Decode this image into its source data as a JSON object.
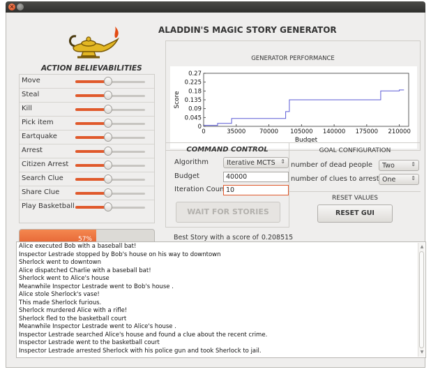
{
  "window": {
    "close_glyph": "×"
  },
  "app_title": "ALADDIN'S MAGIC STORY GENERATOR",
  "logo_icon": "magic-lamp-icon",
  "action_title": "ACTION BELIEVABILITIES",
  "actions": [
    {
      "label": "Move",
      "value": 0.47
    },
    {
      "label": "Steal",
      "value": 0.47
    },
    {
      "label": "Kill",
      "value": 0.47
    },
    {
      "label": "Pick item",
      "value": 0.47
    },
    {
      "label": "Eartquake",
      "value": 0.47
    },
    {
      "label": "Arrest",
      "value": 0.47
    },
    {
      "label": "Citizen Arrest",
      "value": 0.47
    },
    {
      "label": "Search Clue",
      "value": 0.47
    },
    {
      "label": "Share Clue",
      "value": 0.47
    },
    {
      "label": "Play Basketball",
      "value": 0.47
    }
  ],
  "progress": {
    "value": 0.57,
    "label": "57%"
  },
  "performance": {
    "title": "GENERATOR PERFORMANCE",
    "chart_data": {
      "type": "line",
      "xlabel": "Budget",
      "ylabel": "Score",
      "xlim": [
        0,
        220000
      ],
      "ylim": [
        0,
        0.27
      ],
      "xticks": [
        "0",
        "35000",
        "70000",
        "105000",
        "140000",
        "175000",
        "210000"
      ],
      "yticks": [
        "0",
        "0.045",
        "0.09",
        "0.135",
        "0.18",
        "0.225",
        "0.27"
      ],
      "series": [
        {
          "color": "#5a5ad6",
          "x": [
            0,
            15000,
            15000,
            30000,
            30000,
            88000,
            88000,
            92000,
            92000,
            190000,
            190000,
            210000,
            210000,
            215000
          ],
          "y": [
            0.005,
            0.005,
            0.015,
            0.015,
            0.04,
            0.04,
            0.075,
            0.075,
            0.135,
            0.135,
            0.18,
            0.18,
            0.185,
            0.185
          ]
        }
      ]
    }
  },
  "command": {
    "title": "COMMAND CONTROL",
    "algorithm_label": "Algorithm",
    "algorithm_value": "Iterative MCTS",
    "budget_label": "Budget",
    "budget_value": "40000",
    "iteration_label": "Iteration Count",
    "iteration_value": "10",
    "wait_button": "WAIT FOR STORIES"
  },
  "goal": {
    "title": "GOAL CONFIGURATION",
    "dead_label": "number of dead people",
    "dead_value": "Two",
    "clues_label": "number of clues to arrest",
    "clues_value": "One"
  },
  "reset": {
    "title": "RESET VALUES",
    "button": "RESET GUI"
  },
  "best_story": {
    "label": "Best Story with a score of",
    "score": "0.208515"
  },
  "story_lines": [
    "Alice executed Bob with a baseball bat!",
    "Inspector Lestrade stopped by Bob's house on his way to downtown",
    "Sherlock went to downtown",
    "Alice dispatched Charlie with a baseball bat!",
    "Sherlock went to Alice's house",
    "Meanwhile Inspector Lestrade went to Bob's house .",
    "Alice stole Sherlock's vase!",
    "This made Sherlock furious.",
    "Sherlock murdered Alice with a rifle!",
    "Sherlock fled to the basketball court",
    "Meanwhile Inspector Lestrade went to Alice's house .",
    "Inspector Lestrade searched Alice's house and found a clue about the recent crime.",
    "Inspector Lestrade went to the basketball court",
    "Inspector Lestrade arrested Sherlock with his police gun and took Sherlock to jail."
  ]
}
